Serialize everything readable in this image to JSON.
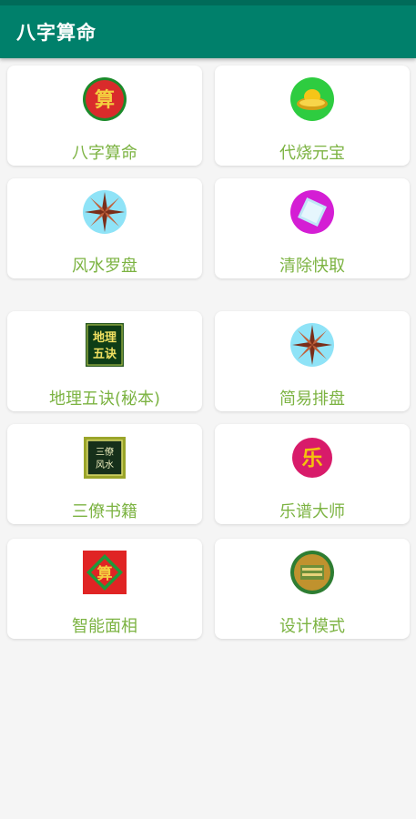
{
  "app": {
    "title": "八字算命"
  },
  "grid": {
    "items": [
      {
        "label": "八字算命",
        "icon": "suan-character-red-circle-icon"
      },
      {
        "label": "代烧元宝",
        "icon": "gold-ingot-icon"
      },
      {
        "label": "风水罗盘",
        "icon": "compass-rose-icon"
      },
      {
        "label": "清除快取",
        "icon": "clear-cache-diamond-icon"
      },
      {
        "label": "地理五诀(秘本)",
        "icon": "dili-wujue-book-cover-icon"
      },
      {
        "label": "简易排盘",
        "icon": "compass-rose-icon"
      },
      {
        "label": "三僚书籍",
        "icon": "sanliao-fengshui-book-icon"
      },
      {
        "label": "乐谱大师",
        "icon": "yue-music-character-icon"
      },
      {
        "label": "智能面相",
        "icon": "face-reading-diamond-icon"
      },
      {
        "label": "设计模式",
        "icon": "design-mode-badge-icon"
      }
    ]
  }
}
